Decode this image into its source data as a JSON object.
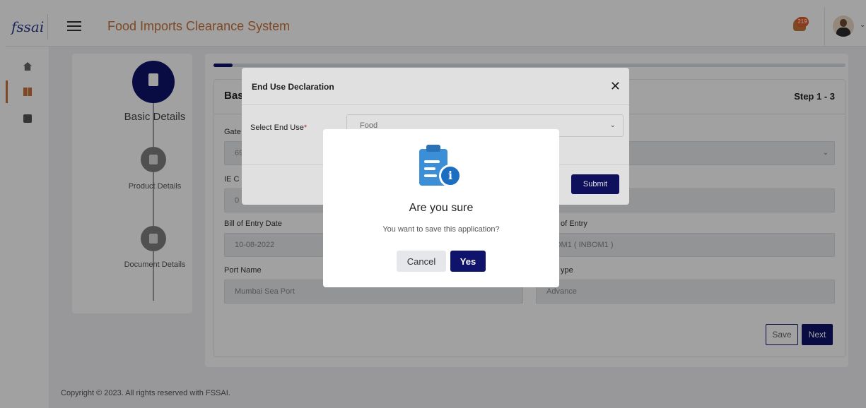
{
  "header": {
    "logo_text": "fssai",
    "app_title": "Food Imports Clearance System",
    "notification_count": "219",
    "icons": {
      "menu": "hamburger-icon",
      "notifications": "bell-icon",
      "profile": "user-avatar"
    }
  },
  "sidebar": {
    "items": [
      {
        "icon": "home-icon",
        "active": false
      },
      {
        "icon": "dashboard-grid-icon",
        "active": true
      },
      {
        "icon": "briefcase-icon",
        "active": false
      }
    ]
  },
  "stepper": {
    "steps": [
      {
        "label": "Basic Details",
        "state": "active"
      },
      {
        "label": "Product Details",
        "state": "pending"
      },
      {
        "label": "Document Details",
        "state": "pending"
      }
    ]
  },
  "form": {
    "section_title": "Basic Details",
    "step_indicator": "Step 1 - 3",
    "progress": 0.03,
    "fields": {
      "gateway_label": "Gate",
      "gateway_value": "69",
      "ie_code_label": "IE C",
      "ie_code_value": "0",
      "bill_date_label": "Bill of Entry Date",
      "bill_date_value": "10-08-2022",
      "port_entry_label": "of Entry",
      "port_entry_value": "OM1 ( INBOM1 )",
      "port_name_label": "Port Name",
      "port_name_value": "Mumbai Sea Port",
      "type_label": "ype",
      "type_value": "Advance"
    },
    "save_label": "Save",
    "next_label": "Next"
  },
  "footer": {
    "copyright": "Copyright © 2023. All rights reserved with FSSAI."
  },
  "end_use_modal": {
    "title": "End Use Declaration",
    "close_glyph": "✕",
    "select_label": "Select End Use",
    "required_mark": "*",
    "selected_value": "Food",
    "submit_label": "Submit"
  },
  "confirm_dialog": {
    "icon": "clipboard-info-icon",
    "title": "Are you sure",
    "message": "You want to save this application?",
    "cancel_label": "Cancel",
    "yes_label": "Yes"
  },
  "colors": {
    "primary": "#10136b",
    "brand_orange": "#c8733a",
    "info_blue": "#3a8fd6"
  }
}
